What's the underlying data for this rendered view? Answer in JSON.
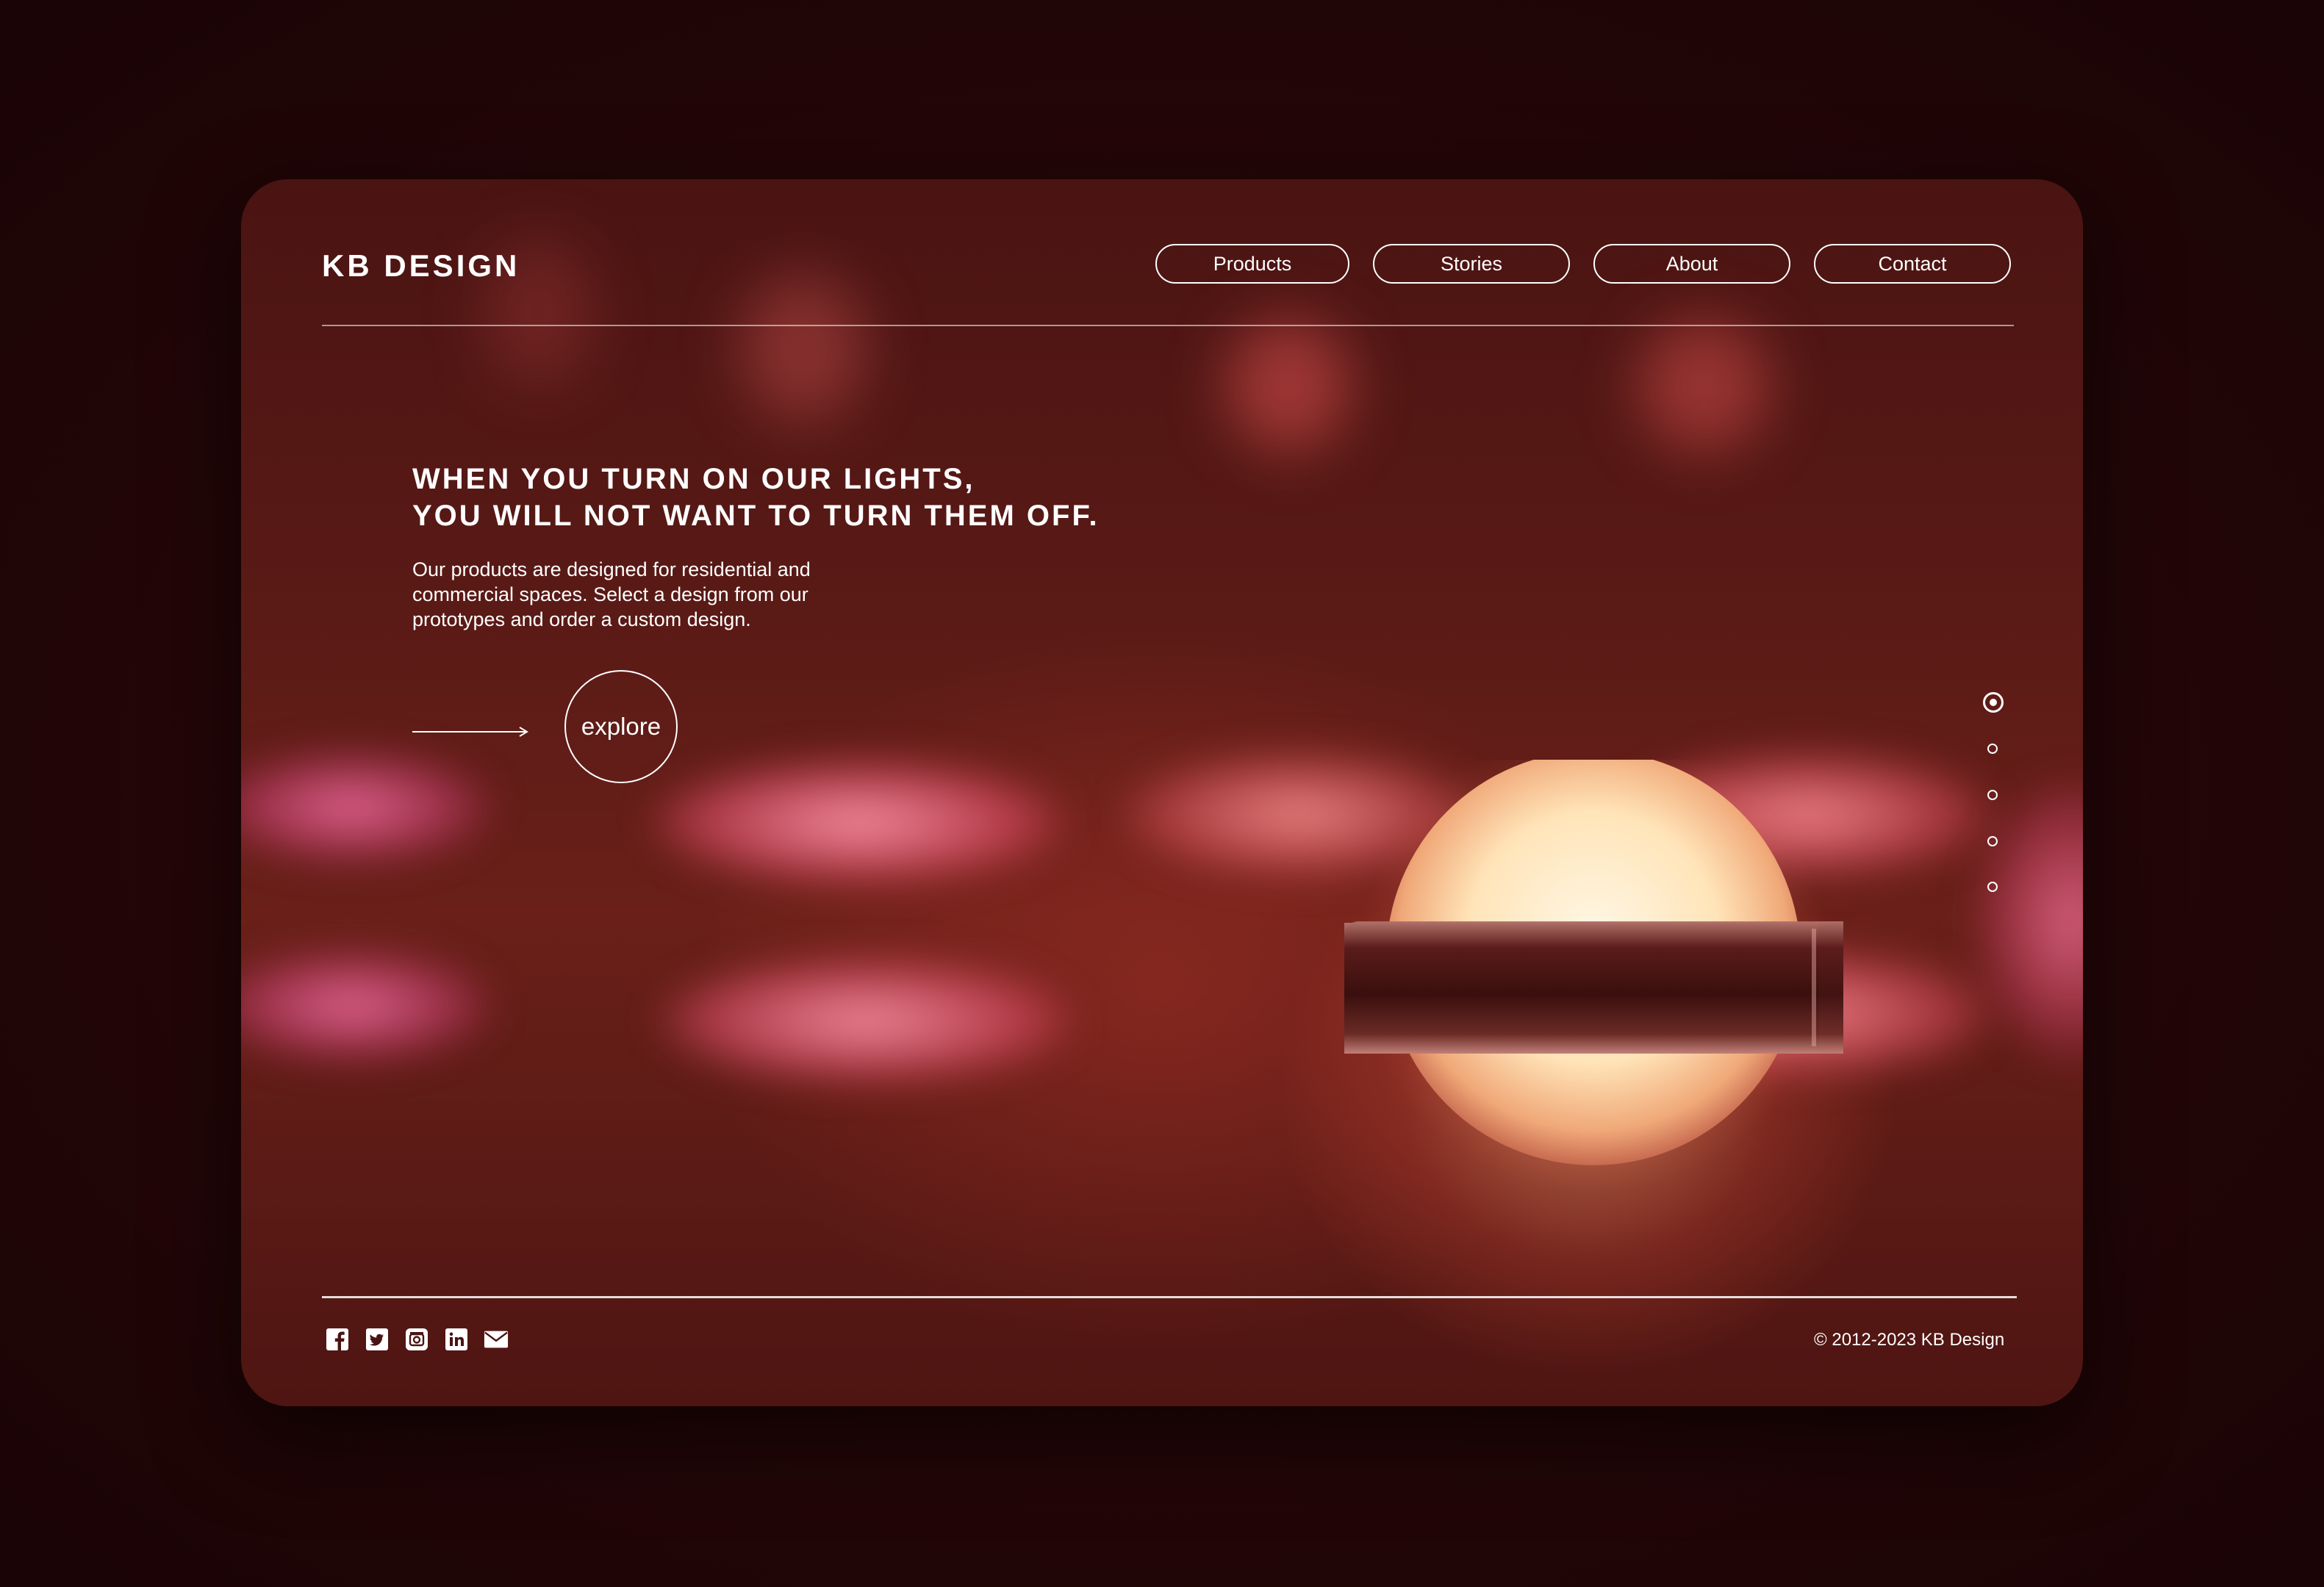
{
  "brand": {
    "logo": "KB DESIGN"
  },
  "nav": {
    "items": [
      {
        "label": "Products"
      },
      {
        "label": "Stories"
      },
      {
        "label": "About"
      },
      {
        "label": "Contact"
      }
    ]
  },
  "hero": {
    "headline_line1": "WHEN YOU TURN ON OUR LIGHTS,",
    "headline_line2": "YOU WILL NOT WANT TO TURN THEM OFF.",
    "description_line1": "Our products are designed for residential and",
    "description_line2": "commercial spaces. Select a design from our",
    "description_line3": "prototypes and order a custom design.",
    "cta_label": "explore",
    "arrow_icon": "arrow-right-icon"
  },
  "slider": {
    "count": 5,
    "active_index": 0
  },
  "footer": {
    "socials": [
      {
        "icon": "facebook-icon"
      },
      {
        "icon": "twitter-icon"
      },
      {
        "icon": "instagram-icon"
      },
      {
        "icon": "linkedin-icon"
      },
      {
        "icon": "mail-icon"
      }
    ],
    "copyright": "© 2012-2023 KB Design"
  },
  "colors": {
    "page_background": "#270708",
    "card_background": "#5a1a16",
    "text": "#ffffff",
    "glow_pink": "#e8507a",
    "glow_orange": "#ff8a5c"
  }
}
